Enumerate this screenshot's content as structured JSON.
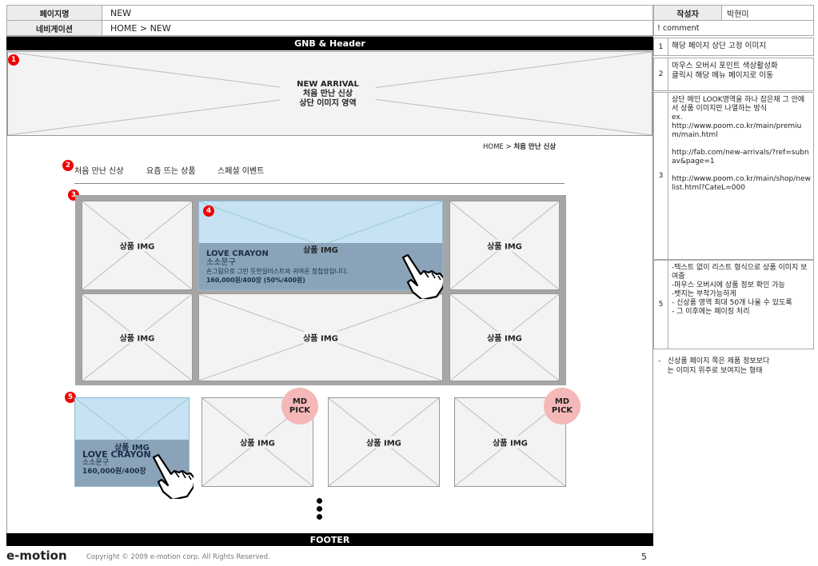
{
  "header": {
    "page_name_label": "페이지명",
    "page_name_value": "NEW",
    "nav_label": "네비게이션",
    "nav_value": "HOME > NEW",
    "author_label": "작성자",
    "author_value": "박현미"
  },
  "gnb_label": "GNB & Header",
  "hero": {
    "line1": "NEW ARRIVAL",
    "line2": "처음 만난 신상",
    "line3": "상단 이미지 영역"
  },
  "breadcrumb": {
    "home": "HOME",
    "sep": " > ",
    "current": "처음 만난 신상"
  },
  "tabs": [
    "처음 만난 신상",
    "요즘 뜨는 상품",
    "스페셜 이벤트"
  ],
  "product_img_label": "상품 IMG",
  "hover_product": {
    "brand": "LOVE CRAYON",
    "category": "소소문구",
    "desc": "손그림으로 그린 듯한일러스트와 귀여운 청첩장입니다.",
    "price": "160,000원/400장 (50%/400원)"
  },
  "list_hover_product": {
    "brand": "LOVE CRAYON",
    "category": "소소문구",
    "price": "160,000원/400장"
  },
  "md_pick": {
    "line1": "MD",
    "line2": "PICK"
  },
  "badges": [
    "1",
    "2",
    "3",
    "4",
    "5"
  ],
  "footer_label": "FOOTER",
  "logo": "e-motion",
  "copyright": "Copyright © 2009 e-motion corp. All Rights Reserved.",
  "page_number": "5",
  "comments": {
    "title": "! comment",
    "rows": [
      {
        "num": "1",
        "text": "해당 페이지 상단 고정 이미지"
      },
      {
        "num": "2",
        "text": "마우스 오버시 포인트 색상활성화\n클릭시 해당 메뉴 페이지로 이동"
      },
      {
        "num": "3",
        "text": "상단 메인 LOOK영역을 하나 잡은채 그 안에서 상품 이미지만 나열하는 방식\nex.\nhttp://www.poom.co.kr/main/premium/main.html\n\nhttp://fab.com/new-arrivals/?ref=subnav&page=1\n\nhttp://www.poom.co.kr/main/shop/newlist.html?CateL=000"
      },
      {
        "num": "5",
        "text": "-텍스트 없이 리스트 형식으로 상품 이미지 보여줌\n-마우스 오버시에 상품 정보 확인 가능\n-뱃지는 부착가능하게\n- 신상품 영역 최대 50개 나올 수 있도록\n- 그 이후에는 페이징 처리"
      }
    ],
    "note": "-   신상품 페이지 쪽은 제품 정보보다\n    는 이미지 위주로 보여지는 형태"
  }
}
